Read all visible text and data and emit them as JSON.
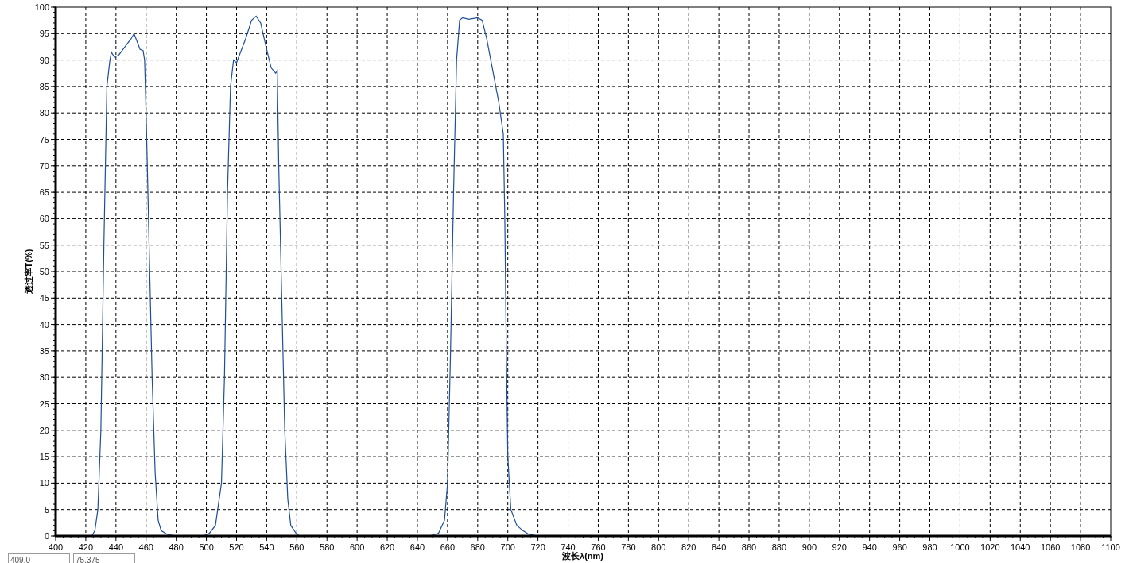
{
  "chart": {
    "chart_data": {
      "type": "line",
      "grid": true,
      "xlabel": "波长λ(nm)",
      "ylabel": "透过率T(%)",
      "xlim": [
        400,
        1100
      ],
      "ylim": [
        0,
        100
      ],
      "xticks": [
        400,
        420,
        440,
        460,
        480,
        500,
        520,
        540,
        560,
        580,
        600,
        620,
        640,
        660,
        680,
        700,
        720,
        740,
        760,
        780,
        800,
        820,
        840,
        860,
        880,
        900,
        920,
        940,
        960,
        980,
        1000,
        1020,
        1040,
        1060,
        1080,
        1100
      ],
      "yticks": [
        0,
        5,
        10,
        15,
        20,
        25,
        30,
        35,
        40,
        45,
        50,
        55,
        60,
        65,
        70,
        75,
        80,
        85,
        90,
        95,
        100
      ],
      "x": [
        400,
        424,
        426,
        428,
        430,
        432,
        434,
        436,
        437,
        439,
        442,
        446,
        450,
        452,
        454,
        456,
        458,
        459,
        460,
        462,
        464,
        466,
        468,
        470,
        474,
        480,
        498,
        502,
        506,
        510,
        512,
        514,
        516,
        518,
        520,
        522,
        526,
        530,
        533,
        536,
        540,
        543,
        546,
        547,
        548,
        550,
        552,
        554,
        556,
        560,
        562,
        648,
        654,
        658,
        660,
        662,
        664,
        666,
        668,
        670,
        674,
        680,
        683,
        686,
        690,
        694,
        697,
        698,
        699,
        700,
        702,
        706,
        710,
        714,
        720,
        1100
      ],
      "series": [
        {
          "color": "#1f4e9c",
          "values": [
            0,
            0,
            1,
            5,
            20,
            55,
            85,
            90,
            91.5,
            90.5,
            91,
            92.5,
            94,
            95,
            93.5,
            92,
            91.8,
            90,
            80,
            55,
            30,
            12,
            3,
            1,
            0.3,
            0,
            0,
            0.5,
            2,
            10,
            30,
            65,
            85,
            90,
            89.5,
            91,
            94,
            97.5,
            98.3,
            97,
            92,
            88.5,
            87.5,
            88,
            70,
            45,
            20,
            7,
            2,
            0.3,
            0,
            0,
            0.5,
            3,
            10,
            35,
            65,
            90,
            97.5,
            98,
            97.7,
            98,
            97.5,
            94,
            88,
            82,
            76,
            60,
            35,
            15,
            5,
            2,
            1,
            0.3,
            0,
            0
          ]
        }
      ]
    }
  },
  "cursor_fields": [
    {
      "value": "409.0"
    },
    {
      "value": "75.375"
    }
  ]
}
